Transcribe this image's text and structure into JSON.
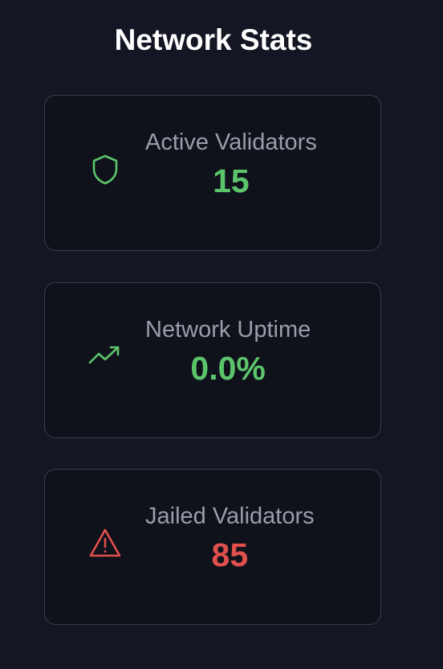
{
  "page": {
    "title": "Network Stats"
  },
  "colors": {
    "background": "#141623",
    "card_background": "#0f111b",
    "card_border": "#3a3e4c",
    "label": "#9a9eaa",
    "positive": "#5cc46a",
    "danger": "#e0504c"
  },
  "stats": [
    {
      "label": "Active Validators",
      "value": "15",
      "icon": "shield-icon",
      "color": "#5cc46a"
    },
    {
      "label": "Network Uptime",
      "value": "0.0%",
      "icon": "trending-up-icon",
      "color": "#5cc46a"
    },
    {
      "label": "Jailed Validators",
      "value": "85",
      "icon": "alert-triangle-icon",
      "color": "#e0504c"
    }
  ]
}
